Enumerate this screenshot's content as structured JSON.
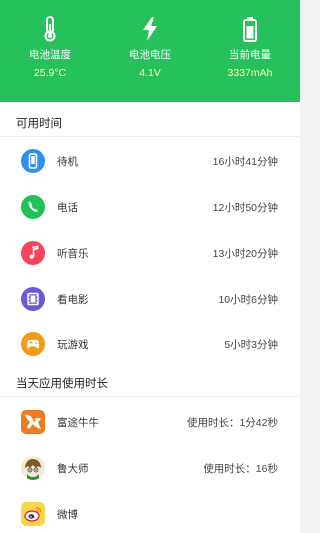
{
  "header": {
    "stats": [
      {
        "label": "电池温度",
        "value": "25.9°C",
        "icon": "thermometer-icon"
      },
      {
        "label": "电池电压",
        "value": "4.1V",
        "icon": "lightning-icon"
      },
      {
        "label": "当前电量",
        "value": "3337mAh",
        "icon": "battery-icon"
      }
    ]
  },
  "available_time": {
    "title": "可用时间",
    "items": [
      {
        "label": "待机",
        "time": "16小时41分钟",
        "icon": "phone-icon",
        "color": "#2e8ff0"
      },
      {
        "label": "电话",
        "time": "12小时50分钟",
        "icon": "call-icon",
        "color": "#22c05a"
      },
      {
        "label": "听音乐",
        "time": "13小时20分钟",
        "icon": "music-icon",
        "color": "#f5455c"
      },
      {
        "label": "看电影",
        "time": "10小时6分钟",
        "icon": "film-icon",
        "color": "#6a5ad8"
      },
      {
        "label": "玩游戏",
        "time": "5小时3分钟",
        "icon": "gamepad-icon",
        "color": "#f49b1a"
      }
    ]
  },
  "app_usage": {
    "title": "当天应用使用时长",
    "items": [
      {
        "label": "富途牛牛",
        "time": "使用时长：1分42秒",
        "icon": "futu-niuniu-icon"
      },
      {
        "label": "鲁大师",
        "time": "使用时长：16秒",
        "icon": "ludashi-icon"
      },
      {
        "label": "微博",
        "time": "",
        "icon": "weibo-icon"
      }
    ]
  }
}
